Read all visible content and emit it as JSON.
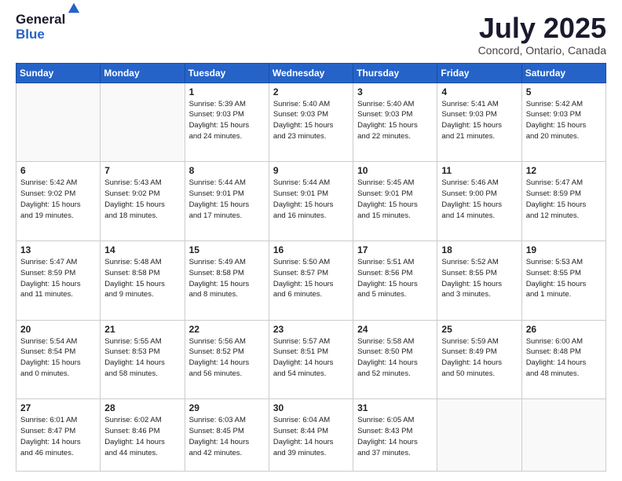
{
  "logo": {
    "general": "General",
    "blue": "Blue"
  },
  "title": "July 2025",
  "location": "Concord, Ontario, Canada",
  "days_of_week": [
    "Sunday",
    "Monday",
    "Tuesday",
    "Wednesday",
    "Thursday",
    "Friday",
    "Saturday"
  ],
  "weeks": [
    [
      {
        "day": "",
        "info": ""
      },
      {
        "day": "",
        "info": ""
      },
      {
        "day": "1",
        "info": "Sunrise: 5:39 AM\nSunset: 9:03 PM\nDaylight: 15 hours\nand 24 minutes."
      },
      {
        "day": "2",
        "info": "Sunrise: 5:40 AM\nSunset: 9:03 PM\nDaylight: 15 hours\nand 23 minutes."
      },
      {
        "day": "3",
        "info": "Sunrise: 5:40 AM\nSunset: 9:03 PM\nDaylight: 15 hours\nand 22 minutes."
      },
      {
        "day": "4",
        "info": "Sunrise: 5:41 AM\nSunset: 9:03 PM\nDaylight: 15 hours\nand 21 minutes."
      },
      {
        "day": "5",
        "info": "Sunrise: 5:42 AM\nSunset: 9:03 PM\nDaylight: 15 hours\nand 20 minutes."
      }
    ],
    [
      {
        "day": "6",
        "info": "Sunrise: 5:42 AM\nSunset: 9:02 PM\nDaylight: 15 hours\nand 19 minutes."
      },
      {
        "day": "7",
        "info": "Sunrise: 5:43 AM\nSunset: 9:02 PM\nDaylight: 15 hours\nand 18 minutes."
      },
      {
        "day": "8",
        "info": "Sunrise: 5:44 AM\nSunset: 9:01 PM\nDaylight: 15 hours\nand 17 minutes."
      },
      {
        "day": "9",
        "info": "Sunrise: 5:44 AM\nSunset: 9:01 PM\nDaylight: 15 hours\nand 16 minutes."
      },
      {
        "day": "10",
        "info": "Sunrise: 5:45 AM\nSunset: 9:01 PM\nDaylight: 15 hours\nand 15 minutes."
      },
      {
        "day": "11",
        "info": "Sunrise: 5:46 AM\nSunset: 9:00 PM\nDaylight: 15 hours\nand 14 minutes."
      },
      {
        "day": "12",
        "info": "Sunrise: 5:47 AM\nSunset: 8:59 PM\nDaylight: 15 hours\nand 12 minutes."
      }
    ],
    [
      {
        "day": "13",
        "info": "Sunrise: 5:47 AM\nSunset: 8:59 PM\nDaylight: 15 hours\nand 11 minutes."
      },
      {
        "day": "14",
        "info": "Sunrise: 5:48 AM\nSunset: 8:58 PM\nDaylight: 15 hours\nand 9 minutes."
      },
      {
        "day": "15",
        "info": "Sunrise: 5:49 AM\nSunset: 8:58 PM\nDaylight: 15 hours\nand 8 minutes."
      },
      {
        "day": "16",
        "info": "Sunrise: 5:50 AM\nSunset: 8:57 PM\nDaylight: 15 hours\nand 6 minutes."
      },
      {
        "day": "17",
        "info": "Sunrise: 5:51 AM\nSunset: 8:56 PM\nDaylight: 15 hours\nand 5 minutes."
      },
      {
        "day": "18",
        "info": "Sunrise: 5:52 AM\nSunset: 8:55 PM\nDaylight: 15 hours\nand 3 minutes."
      },
      {
        "day": "19",
        "info": "Sunrise: 5:53 AM\nSunset: 8:55 PM\nDaylight: 15 hours\nand 1 minute."
      }
    ],
    [
      {
        "day": "20",
        "info": "Sunrise: 5:54 AM\nSunset: 8:54 PM\nDaylight: 15 hours\nand 0 minutes."
      },
      {
        "day": "21",
        "info": "Sunrise: 5:55 AM\nSunset: 8:53 PM\nDaylight: 14 hours\nand 58 minutes."
      },
      {
        "day": "22",
        "info": "Sunrise: 5:56 AM\nSunset: 8:52 PM\nDaylight: 14 hours\nand 56 minutes."
      },
      {
        "day": "23",
        "info": "Sunrise: 5:57 AM\nSunset: 8:51 PM\nDaylight: 14 hours\nand 54 minutes."
      },
      {
        "day": "24",
        "info": "Sunrise: 5:58 AM\nSunset: 8:50 PM\nDaylight: 14 hours\nand 52 minutes."
      },
      {
        "day": "25",
        "info": "Sunrise: 5:59 AM\nSunset: 8:49 PM\nDaylight: 14 hours\nand 50 minutes."
      },
      {
        "day": "26",
        "info": "Sunrise: 6:00 AM\nSunset: 8:48 PM\nDaylight: 14 hours\nand 48 minutes."
      }
    ],
    [
      {
        "day": "27",
        "info": "Sunrise: 6:01 AM\nSunset: 8:47 PM\nDaylight: 14 hours\nand 46 minutes."
      },
      {
        "day": "28",
        "info": "Sunrise: 6:02 AM\nSunset: 8:46 PM\nDaylight: 14 hours\nand 44 minutes."
      },
      {
        "day": "29",
        "info": "Sunrise: 6:03 AM\nSunset: 8:45 PM\nDaylight: 14 hours\nand 42 minutes."
      },
      {
        "day": "30",
        "info": "Sunrise: 6:04 AM\nSunset: 8:44 PM\nDaylight: 14 hours\nand 39 minutes."
      },
      {
        "day": "31",
        "info": "Sunrise: 6:05 AM\nSunset: 8:43 PM\nDaylight: 14 hours\nand 37 minutes."
      },
      {
        "day": "",
        "info": ""
      },
      {
        "day": "",
        "info": ""
      }
    ]
  ]
}
